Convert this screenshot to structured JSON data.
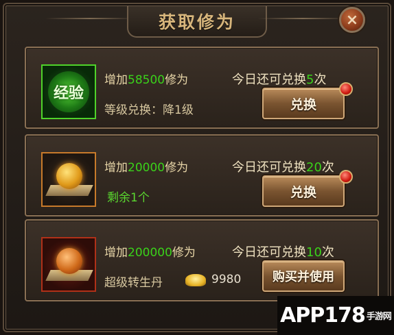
{
  "dialog": {
    "title": "获取修为",
    "close_label": "×"
  },
  "rows": [
    {
      "icon": "experience-orb-icon",
      "icon_text": "经验",
      "gain_prefix": "增加",
      "gain_amount": "58500",
      "gain_suffix": "修为",
      "sub_text": "等级兑换：降1级",
      "remaining_prefix": "今日还可兑换",
      "remaining_count": "5",
      "remaining_suffix": "次",
      "button_label": "兑换",
      "has_notification": true
    },
    {
      "icon": "golden-orb-icon",
      "gain_prefix": "增加",
      "gain_amount": "20000",
      "gain_suffix": "修为",
      "sub_text": "剩余1个",
      "remaining_prefix": "今日还可兑换",
      "remaining_count": "20",
      "remaining_suffix": "次",
      "button_label": "兑换",
      "has_notification": true
    },
    {
      "icon": "super-rebirth-pill-icon",
      "gain_prefix": "增加",
      "gain_amount": "200000",
      "gain_suffix": "修为",
      "sub_text": "超级转生丹",
      "price_icon": "gold-ingot-icon",
      "price": "9980",
      "remaining_prefix": "今日还可兑换",
      "remaining_count": "10",
      "remaining_suffix": "次",
      "button_label": "购买并使用",
      "has_notification": false
    }
  ],
  "watermark": {
    "text": "APP178",
    "suffix": "手游网"
  },
  "colors": {
    "highlight_green": "#3ad21a",
    "gold_text": "#d8b67c",
    "panel_border": "#8a7054"
  }
}
